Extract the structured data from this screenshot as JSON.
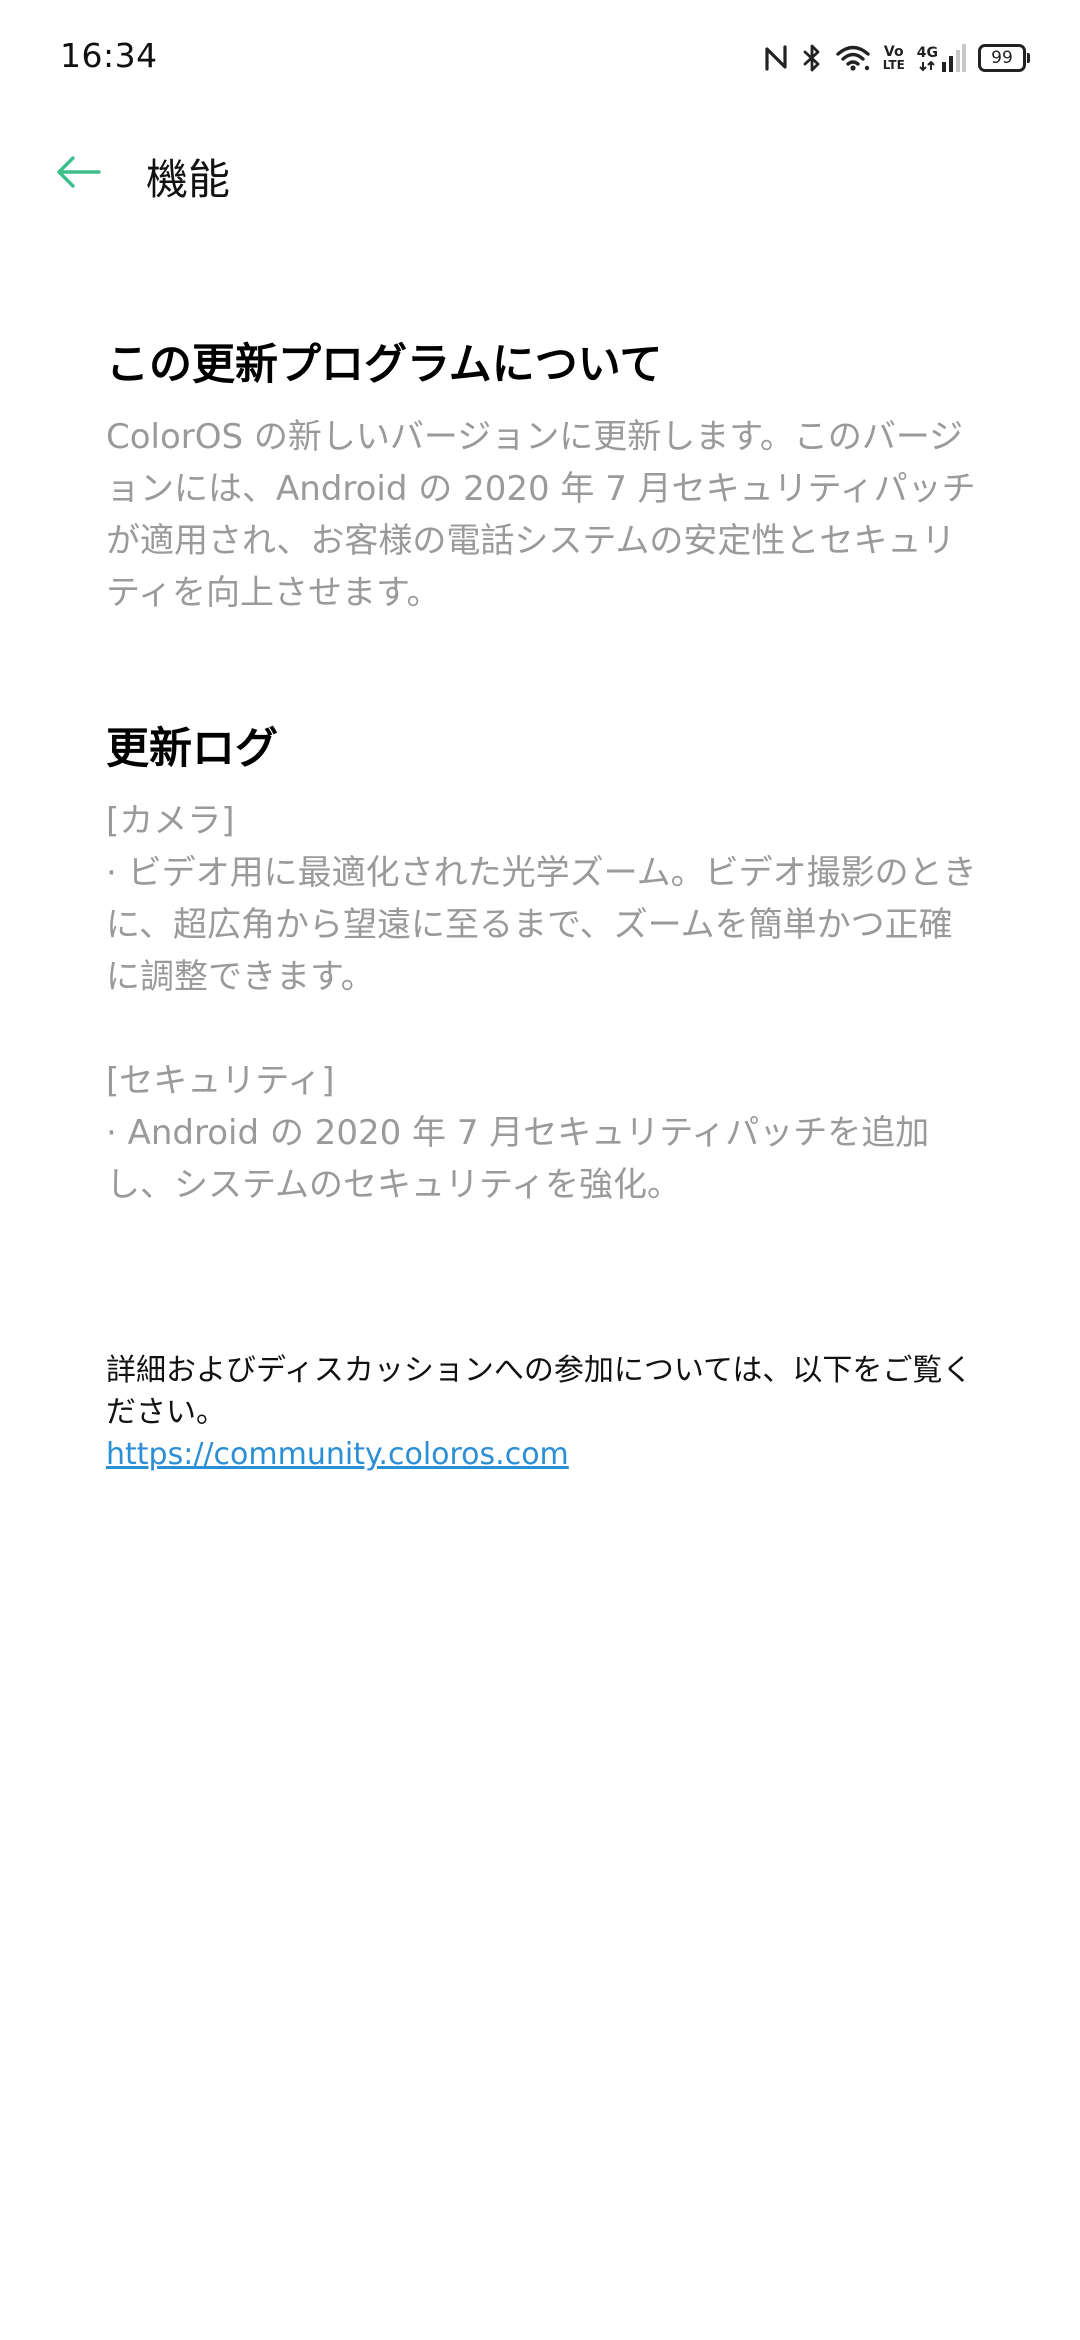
{
  "status_bar": {
    "time": "16:34",
    "battery_level": "99",
    "icons": [
      "nfc-icon",
      "bluetooth-icon",
      "wifi-icon",
      "volte-icon",
      "4g-signal-icon",
      "battery-icon"
    ],
    "volte_label_top": "Vo",
    "volte_label_bottom": "LTE",
    "network_label": "4G"
  },
  "header": {
    "title": "機能",
    "back_icon": "arrow-left-icon",
    "accent_color": "#3cbf8a"
  },
  "about": {
    "heading": "この更新プログラムについて",
    "body": "ColorOS の新しいバージョンに更新します。このバージョンには、Android の 2020 年 7 月セキュリティパッチが適用され、お客様の電話システムの安定性とセキュリティを向上させます。"
  },
  "update_log": {
    "heading": "更新ログ",
    "sections": [
      {
        "title": "[カメラ]",
        "item": "· ビデオ用に最適化された光学ズーム。ビデオ撮影のときに、超広角から望遠に至るまで、ズームを簡単かつ正確に調整できます。"
      },
      {
        "title": "[セキュリティ]",
        "item": "· Android の 2020 年 7 月セキュリティパッチを追加し、システムのセキュリティを強化。"
      }
    ]
  },
  "footer": {
    "text": "詳細およびディスカッションへの参加については、以下をご覧ください。",
    "link": "https://community.coloros.com",
    "link_color": "#2c8fd6"
  }
}
